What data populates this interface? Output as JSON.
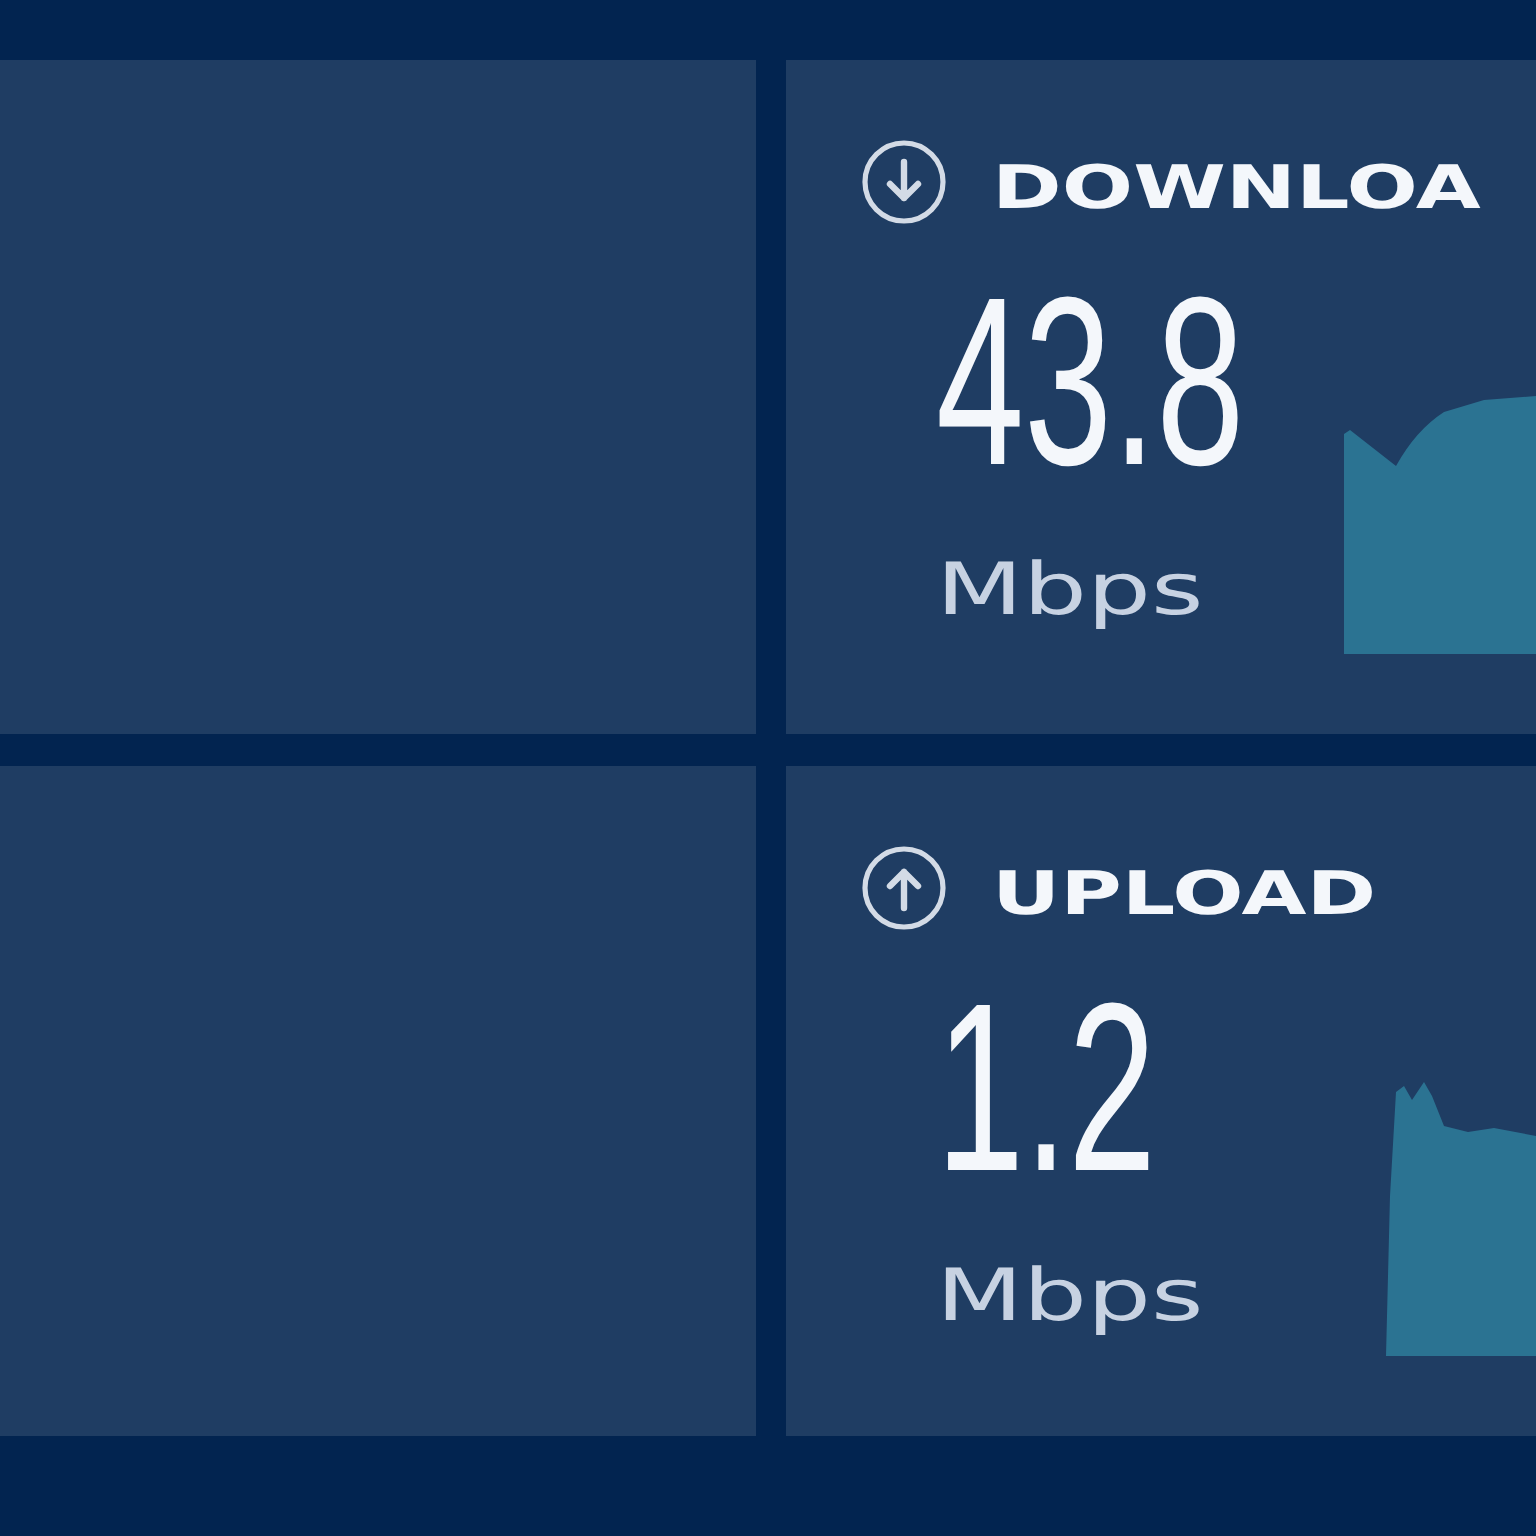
{
  "tiles": [
    {
      "kind": "empty"
    },
    {
      "kind": "download",
      "title": "DOWNLOA",
      "value": "43.8",
      "unit": "Mbps"
    },
    {
      "kind": "empty"
    },
    {
      "kind": "upload",
      "title": "UPLOAD",
      "value": "1.2",
      "unit": "Mbps"
    }
  ]
}
